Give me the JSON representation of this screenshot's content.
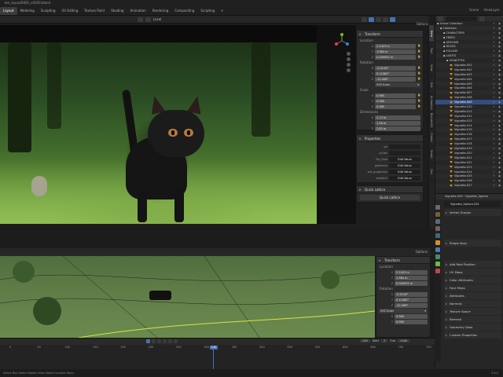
{
  "window": {
    "title": "bm_layout0002_v0200.blend"
  },
  "workspaces": [
    "Modeling",
    "Sculpting",
    "UV Editing",
    "Texture Paint",
    "Shading",
    "Animation",
    "Rendering",
    "Compositing",
    "Scripting",
    "+"
  ],
  "active_workspace": "Layout",
  "top_right": {
    "scene": "Scene",
    "view_layer": "ViewLayer"
  },
  "viewport_header": {
    "view_mode": "Local",
    "options": "Options"
  },
  "n_panel": {
    "tabs": [
      "Item",
      "Tool",
      "View",
      "Edit",
      "Animation",
      "BlenderKit",
      "Create",
      "Smart",
      "Gen"
    ],
    "transform": {
      "header": "Transform",
      "location_label": "Location",
      "location": [
        {
          "axis": "X",
          "value": "2.1423 m"
        },
        {
          "axis": "Y",
          "value": "1.984 m"
        },
        {
          "axis": "Z",
          "value": "0.000052 m"
        }
      ],
      "rotation_label": "Rotation",
      "rotation": [
        {
          "axis": "X",
          "value": "-0.0116°"
        },
        {
          "axis": "Y",
          "value": "0.11080°"
        },
        {
          "axis": "Z",
          "value": "-22.498°"
        }
      ],
      "rotation_mode": "XYZ Euler",
      "scale_label": "Scale",
      "scale": [
        {
          "axis": "X",
          "value": "0.965"
        },
        {
          "axis": "Y",
          "value": "0.965"
        },
        {
          "axis": "Z",
          "value": "0.965"
        }
      ],
      "dimensions_label": "Dimensions",
      "dimensions": [
        {
          "axis": "X",
          "value": "2.13 m"
        },
        {
          "axis": "Y",
          "value": "1.46 m"
        },
        {
          "axis": "Z",
          "value": "2.83 m"
        }
      ]
    },
    "properties": {
      "header": "Properties",
      "rows": [
        {
          "label": "uis",
          "value": ""
        },
        {
          "label": "cycles",
          "value": ""
        },
        {
          "label": "flip_fluid",
          "value": "Edit Value"
        },
        {
          "label": "geofence",
          "value": "Edit Value"
        },
        {
          "label": "ant_properties",
          "value": "Edit Value"
        },
        {
          "label": "scatter5",
          "value": "Edit Value"
        }
      ]
    },
    "quick_lattice": {
      "header": "Quick Lattice",
      "button": "Quick Lattice"
    }
  },
  "outliner": {
    "rows": [
      {
        "label": "Scene Collection",
        "indent": 0,
        "tri": false,
        "sel": false
      },
      {
        "label": "Collection",
        "indent": 1,
        "tri": false,
        "sel": false
      },
      {
        "label": "CHARACTERS",
        "indent": 2,
        "tri": false,
        "sel": false
      },
      {
        "label": "TREES",
        "indent": 2,
        "tri": false,
        "sel": false
      },
      {
        "label": "GROUND",
        "indent": 2,
        "tri": false,
        "sel": false
      },
      {
        "label": "ROCKS",
        "indent": 2,
        "tri": false,
        "sel": false
      },
      {
        "label": "FOLIAGE",
        "indent": 2,
        "tri": false,
        "sel": false
      },
      {
        "label": "LIGHTS",
        "indent": 2,
        "tri": false,
        "sel": false
      },
      {
        "label": "VIGNETTES",
        "indent": 3,
        "tri": false,
        "sel": false
      },
      {
        "label": "Vignette.001",
        "indent": 4,
        "tri": true,
        "sel": false
      },
      {
        "label": "Vignette.002",
        "indent": 4,
        "tri": true,
        "sel": false
      },
      {
        "label": "Vignette.003",
        "indent": 4,
        "tri": true,
        "sel": false
      },
      {
        "label": "Vignette.004",
        "indent": 4,
        "tri": true,
        "sel": false
      },
      {
        "label": "Vignette.005",
        "indent": 4,
        "tri": true,
        "sel": false
      },
      {
        "label": "Vignette.006",
        "indent": 4,
        "tri": true,
        "sel": false
      },
      {
        "label": "Vignette.007",
        "indent": 4,
        "tri": true,
        "sel": false
      },
      {
        "label": "Vignette.008",
        "indent": 4,
        "tri": true,
        "sel": false
      },
      {
        "label": "Vignette.009",
        "indent": 4,
        "tri": true,
        "sel": true
      },
      {
        "label": "Vignette.010",
        "indent": 4,
        "tri": true,
        "sel": false
      },
      {
        "label": "Vignette.011",
        "indent": 4,
        "tri": true,
        "sel": false
      },
      {
        "label": "Vignette.012",
        "indent": 4,
        "tri": true,
        "sel": false
      },
      {
        "label": "Vignette.013",
        "indent": 4,
        "tri": true,
        "sel": false
      },
      {
        "label": "Vignette.014",
        "indent": 4,
        "tri": true,
        "sel": false
      },
      {
        "label": "Vignette.015",
        "indent": 4,
        "tri": true,
        "sel": false
      },
      {
        "label": "Vignette.016",
        "indent": 4,
        "tri": true,
        "sel": false
      },
      {
        "label": "Vignette.017",
        "indent": 4,
        "tri": true,
        "sel": false
      },
      {
        "label": "Vignette.018",
        "indent": 4,
        "tri": true,
        "sel": false
      },
      {
        "label": "Vignette.019",
        "indent": 4,
        "tri": true,
        "sel": false
      },
      {
        "label": "Vignette.020",
        "indent": 4,
        "tri": true,
        "sel": false
      },
      {
        "label": "Vignette.021",
        "indent": 4,
        "tri": true,
        "sel": false
      },
      {
        "label": "Vignette.022",
        "indent": 4,
        "tri": true,
        "sel": false
      },
      {
        "label": "Vignette.023",
        "indent": 4,
        "tri": true,
        "sel": false
      },
      {
        "label": "Vignette.024",
        "indent": 4,
        "tri": true,
        "sel": false
      },
      {
        "label": "Vignette.025",
        "indent": 4,
        "tri": true,
        "sel": false
      },
      {
        "label": "Vignette.026",
        "indent": 4,
        "tri": true,
        "sel": false
      },
      {
        "label": "Vignette.027",
        "indent": 4,
        "tri": true,
        "sel": false
      }
    ]
  },
  "properties_editor": {
    "object_name": "Vignette.009",
    "data_name": "Vignette_Sphere",
    "mesh_name": "Vignette_Sphere.032",
    "sections": [
      "Vertex Groups",
      "Shape Keys",
      "Add Rest Position",
      "UV Maps",
      "Color Attributes",
      "Face Maps",
      "Attributes",
      "Normals",
      "Texture Space",
      "Remesh",
      "Geometry Data",
      "Custom Properties"
    ]
  },
  "lower_n_panel": {
    "header": "Transform",
    "location_label": "Location",
    "location": [
      {
        "axis": "X",
        "value": "2.1423 m"
      },
      {
        "axis": "Y",
        "value": "1.984 m"
      },
      {
        "axis": "Z",
        "value": "0.000052 m"
      }
    ],
    "rotation_label": "Rotation",
    "rotation": [
      {
        "axis": "X",
        "value": "-0.0116°"
      },
      {
        "axis": "Y",
        "value": "0.11080°"
      },
      {
        "axis": "Z",
        "value": "-22.498°"
      }
    ],
    "rotation_mode": "XYZ Euler",
    "scale": [
      {
        "axis": "X",
        "value": "0.965"
      },
      {
        "axis": "Y",
        "value": "0.965"
      }
    ],
    "options": "Options"
  },
  "timeline": {
    "current_frame": "140",
    "start_label": "Start",
    "start": "1",
    "end_label": "End",
    "end": "1160",
    "ticks": [
      "0",
      "50",
      "100",
      "150",
      "200",
      "250",
      "300",
      "350",
      "400",
      "450",
      "500",
      "550",
      "600",
      "650",
      "700",
      "750"
    ]
  },
  "statusbar": {
    "text": "Select   Box Select   Rotate View   Object Context Menu",
    "version": "3.6.0"
  },
  "colors": {
    "accent": "#4772b3",
    "selected_row": "#334d80",
    "panel_bg": "#2b2b2b",
    "collection_icon": "#d98d24"
  }
}
